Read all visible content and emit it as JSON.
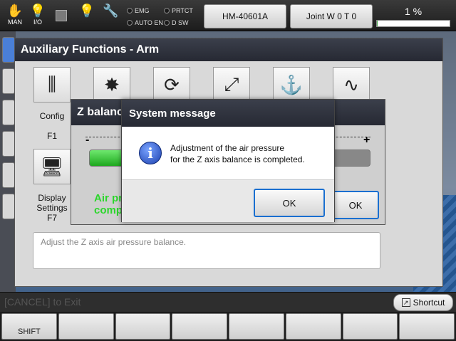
{
  "topbar": {
    "mode_label": "MAN",
    "io_label": "I/O",
    "indicators": {
      "emg": "EMG",
      "prtct": "PRTCT",
      "auto_en": "AUTO EN",
      "dsw": "D SW"
    },
    "robot_button": "HM-40601A",
    "coord_button": "Joint W 0 T 0",
    "speed": "1 %",
    "speed_fraction": 0.01
  },
  "aux": {
    "title": "Auxiliary Functions - Arm",
    "functions": [
      {
        "label": "Config",
        "key": "F1",
        "icon": "three-tools-icon"
      },
      {
        "label": "",
        "key": "",
        "icon": "burst-icon"
      },
      {
        "label": "",
        "key": "",
        "icon": "rotate-arm-icon"
      },
      {
        "label": "",
        "key": "",
        "icon": "axis-icon"
      },
      {
        "label": "",
        "key": "",
        "icon": "hook-icon"
      },
      {
        "label": "",
        "key": "",
        "icon": "path-icon"
      },
      {
        "label": "Display Settings",
        "key": "F7",
        "icon": "monitor-gear-icon"
      }
    ],
    "description": "Adjust the Z axis air pressure balance."
  },
  "zbalance": {
    "title": "Z balanc",
    "minus": "-",
    "plus": "+",
    "bar_fraction": 0.14,
    "message": "Air pr",
    "message2": "comp",
    "ok": "OK"
  },
  "system_message": {
    "title": "System message",
    "icon": "info-icon",
    "line1": "Adjustment of the air pressure",
    "line2": "for the Z axis balance is completed.",
    "ok": "OK"
  },
  "bottom": {
    "guide": "[CANCEL] to Exit",
    "shortcut": "Shortcut",
    "fkeys": [
      "SHIFT",
      "",
      "",
      "",
      "",
      "",
      "",
      ""
    ]
  }
}
